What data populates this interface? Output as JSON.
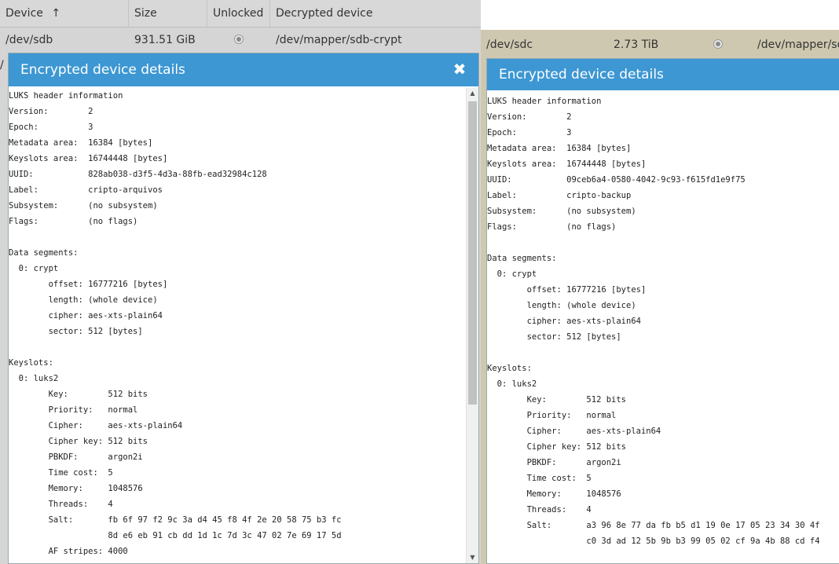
{
  "table": {
    "headers": {
      "device": "Device",
      "sort_arrow": "↑",
      "size": "Size",
      "unlocked": "Unlocked",
      "decrypted": "Decrypted device"
    },
    "rows": [
      {
        "device": "/dev/sdb",
        "size": "931.51 GiB",
        "unlocked": true,
        "decrypted": "/dev/mapper/sdb-crypt"
      },
      {
        "device": "/dev/sdc",
        "size": "2.73 TiB",
        "unlocked": true,
        "decrypted": "/dev/mapper/sdc"
      }
    ],
    "partial_row_glyph": "/"
  },
  "dialogs": [
    {
      "title": "Encrypted device details",
      "close": "✖",
      "lines": [
        "LUKS header information",
        "Version:        2",
        "Epoch:          3",
        "Metadata area:  16384 [bytes]",
        "Keyslots area:  16744448 [bytes]",
        "UUID:           828ab038-d3f5-4d3a-88fb-ead32984c128",
        "Label:          cripto-arquivos",
        "Subsystem:      (no subsystem)",
        "Flags:          (no flags)",
        "",
        "Data segments:",
        "  0: crypt",
        "        offset: 16777216 [bytes]",
        "        length: (whole device)",
        "        cipher: aes-xts-plain64",
        "        sector: 512 [bytes]",
        "",
        "Keyslots:",
        "  0: luks2",
        "        Key:        512 bits",
        "        Priority:   normal",
        "        Cipher:     aes-xts-plain64",
        "        Cipher key: 512 bits",
        "        PBKDF:      argon2i",
        "        Time cost:  5",
        "        Memory:     1048576",
        "        Threads:    4",
        "        Salt:       fb 6f 97 f2 9c 3a d4 45 f8 4f 2e 20 58 75 b3 fc",
        "                    8d e6 eb 91 cb dd 1d 1c 7d 3c 47 02 7e 69 17 5d",
        "        AF stripes: 4000"
      ]
    },
    {
      "title": "Encrypted device details",
      "lines": [
        "LUKS header information",
        "Version:        2",
        "Epoch:          3",
        "Metadata area:  16384 [bytes]",
        "Keyslots area:  16744448 [bytes]",
        "UUID:           09ceb6a4-0580-4042-9c93-f615fd1e9f75",
        "Label:          cripto-backup",
        "Subsystem:      (no subsystem)",
        "Flags:          (no flags)",
        "",
        "Data segments:",
        "  0: crypt",
        "        offset: 16777216 [bytes]",
        "        length: (whole device)",
        "        cipher: aes-xts-plain64",
        "        sector: 512 [bytes]",
        "",
        "Keyslots:",
        "  0: luks2",
        "        Key:        512 bits",
        "        Priority:   normal",
        "        Cipher:     aes-xts-plain64",
        "        Cipher key: 512 bits",
        "        PBKDF:      argon2i",
        "        Time cost:  5",
        "        Memory:     1048576",
        "        Threads:    4",
        "        Salt:       a3 96 8e 77 da fb b5 d1 19 0e 17 05 23 34 30 4f",
        "                    c0 3d ad 12 5b 9b b3 99 05 02 cf 9a 4b 88 cd f4"
      ]
    }
  ],
  "scrollbar": {
    "up": "▲",
    "down": "▼"
  }
}
